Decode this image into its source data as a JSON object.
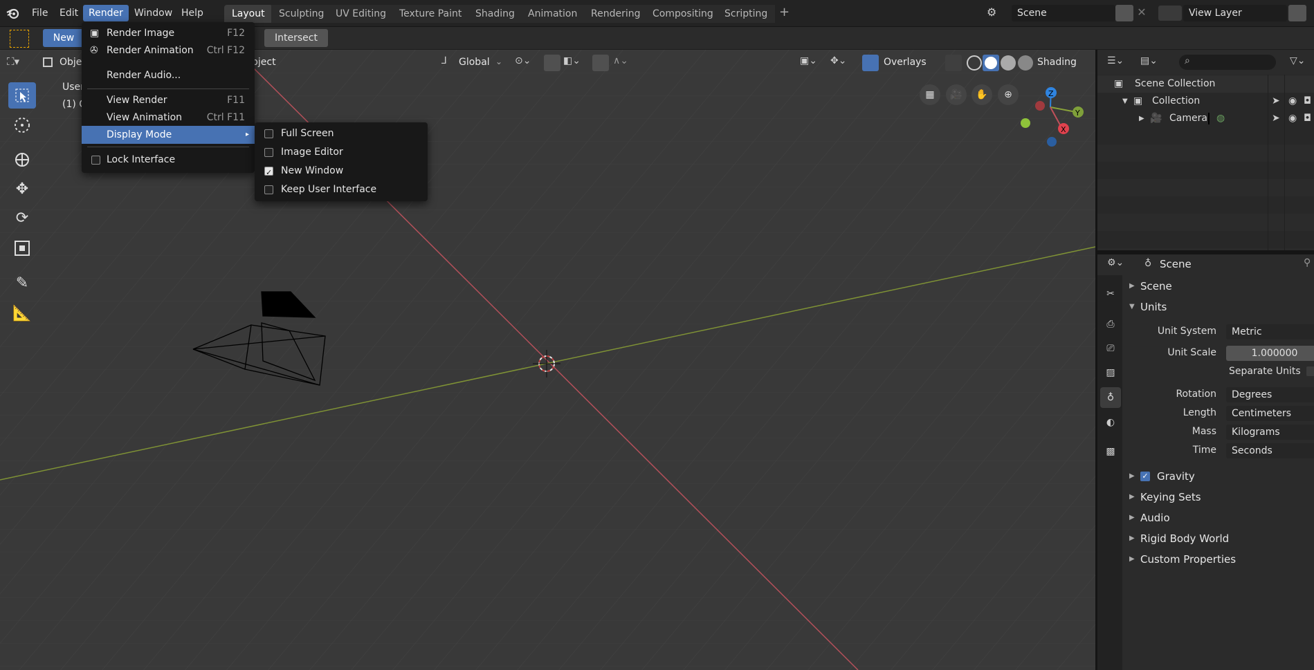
{
  "topbar": {
    "menus": [
      "File",
      "Edit",
      "Render",
      "Window",
      "Help"
    ],
    "workspaces": [
      "Layout",
      "Sculpting",
      "UV Editing",
      "Texture Paint",
      "Shading",
      "Animation",
      "Rendering",
      "Compositing",
      "Scripting"
    ],
    "add_tab": "+",
    "scene_name": "Scene",
    "view_layer": "View Layer"
  },
  "toolheader": {
    "new_label": "New",
    "intersect_label": "Intersect"
  },
  "viewport_header": {
    "mode_label": "Objec",
    "menu_fragment": "bject",
    "orientation": "Global",
    "overlays_label": "Overlays",
    "shading_label": "Shading"
  },
  "viewport": {
    "view_name": "User",
    "collection_info": "(1) Co"
  },
  "render_menu": {
    "items": [
      {
        "label": "Render Image",
        "shortcut": "F12"
      },
      {
        "label": "Render Animation",
        "shortcut": "Ctrl F12"
      },
      {
        "label": "Render Audio...",
        "shortcut": ""
      },
      {
        "label": "View Render",
        "shortcut": "F11"
      },
      {
        "label": "View Animation",
        "shortcut": "Ctrl F11"
      },
      {
        "label": "Display Mode",
        "shortcut": ""
      },
      {
        "label": "Lock Interface",
        "shortcut": ""
      }
    ]
  },
  "display_mode_menu": {
    "items": [
      {
        "label": "Full Screen",
        "checked": false
      },
      {
        "label": "Image Editor",
        "checked": false
      },
      {
        "label": "New Window",
        "checked": true
      },
      {
        "label": "Keep User Interface",
        "checked": false
      }
    ]
  },
  "outliner": {
    "root": "Scene Collection",
    "collection": "Collection",
    "object": "Camera"
  },
  "properties": {
    "context": "Scene",
    "panels": {
      "scene": "Scene",
      "units": "Units",
      "gravity": "Gravity",
      "keying_sets": "Keying Sets",
      "audio": "Audio",
      "rigid_body_world": "Rigid Body World",
      "custom_properties": "Custom Properties"
    },
    "units": {
      "unit_system_label": "Unit System",
      "unit_system": "Metric",
      "unit_scale_label": "Unit Scale",
      "unit_scale": "1.000000",
      "separate_units_label": "Separate Units",
      "rotation_label": "Rotation",
      "rotation": "Degrees",
      "length_label": "Length",
      "length": "Centimeters",
      "mass_label": "Mass",
      "mass": "Kilograms",
      "time_label": "Time",
      "time": "Seconds"
    },
    "gravity_enabled": true
  },
  "colors": {
    "accent": "#4772b3",
    "x_axis": "#c0505a",
    "y_axis": "#8aa33a",
    "z_axis": "#2f84e0"
  }
}
